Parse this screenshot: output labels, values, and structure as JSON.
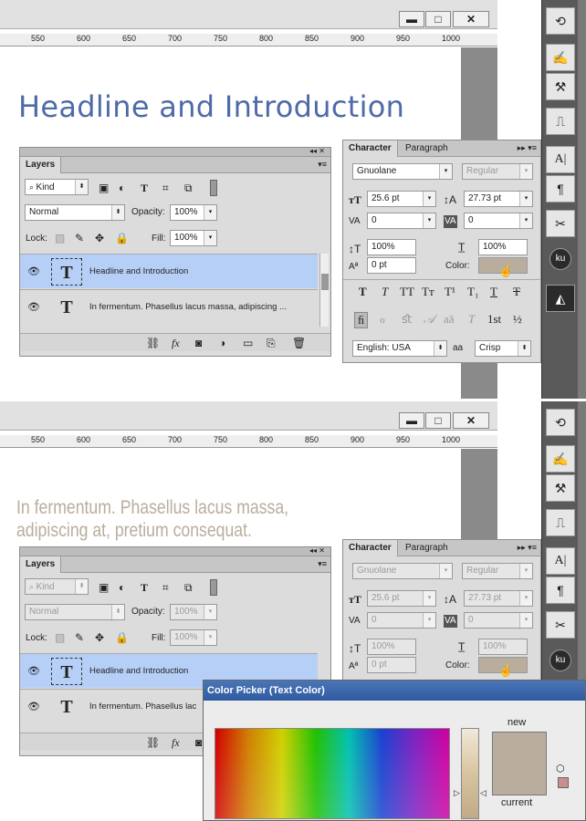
{
  "window": {
    "minimize": "▬",
    "maximize": "□",
    "close": "✕"
  },
  "ruler": {
    "ticks": [
      "550",
      "600",
      "650",
      "700",
      "750",
      "800",
      "850",
      "900",
      "950",
      "1000"
    ]
  },
  "screen1": {
    "canvas_headline": "Headline and Introduction"
  },
  "screen2": {
    "canvas_text_line1": "In fermentum. Phasellus lacus massa,",
    "canvas_text_line2": "adipiscing at, pretium consequat."
  },
  "layers_panel": {
    "tab": "Layers",
    "filter_kind": "Kind",
    "blend_mode": "Normal",
    "opacity_label": "Opacity:",
    "opacity_value": "100%",
    "lock_label": "Lock:",
    "fill_label": "Fill:",
    "fill_value": "100%",
    "layers": [
      {
        "name": "Headline and Introduction",
        "thumb": "T"
      },
      {
        "name": "In fermentum. Phasellus lacus massa, adipiscing ...",
        "thumb": "T"
      }
    ],
    "layers_s2": [
      {
        "name": "Headline and Introduction",
        "thumb": "T"
      },
      {
        "name": "In fermentum. Phasellus lac",
        "thumb": "T"
      }
    ],
    "fx": "fx"
  },
  "character_panel": {
    "tab_character": "Character",
    "tab_paragraph": "Paragraph",
    "font_family": "Gnuolane",
    "font_style": "Regular",
    "font_size": "25.6 pt",
    "leading": "27.73 pt",
    "kerning": "0",
    "tracking": "0",
    "vertical_scale": "100%",
    "horizontal_scale": "100%",
    "baseline_shift": "0 pt",
    "color_label": "Color:",
    "color_value": "#b9ad9e",
    "type_styles": [
      "T",
      "T",
      "TT",
      "Tт",
      "T¹",
      "T₁",
      "T",
      "T"
    ],
    "opentype": [
      "ﬁ",
      "ℴ",
      "ﬆ",
      "𝒜",
      "aā",
      "T",
      "1st",
      "½"
    ],
    "language": "English: USA",
    "aa_label": "aa",
    "antialias": "Crisp"
  },
  "color_picker": {
    "title": "Color Picker (Text Color)",
    "new_label": "new",
    "current_label": "current",
    "new_color": "#b9ad9e"
  },
  "side_panel": {
    "ku_label": "ku"
  },
  "colors": {
    "headline": "#4f6aa8",
    "body_text": "#b9ad9e",
    "selection": "#b6cff7"
  }
}
